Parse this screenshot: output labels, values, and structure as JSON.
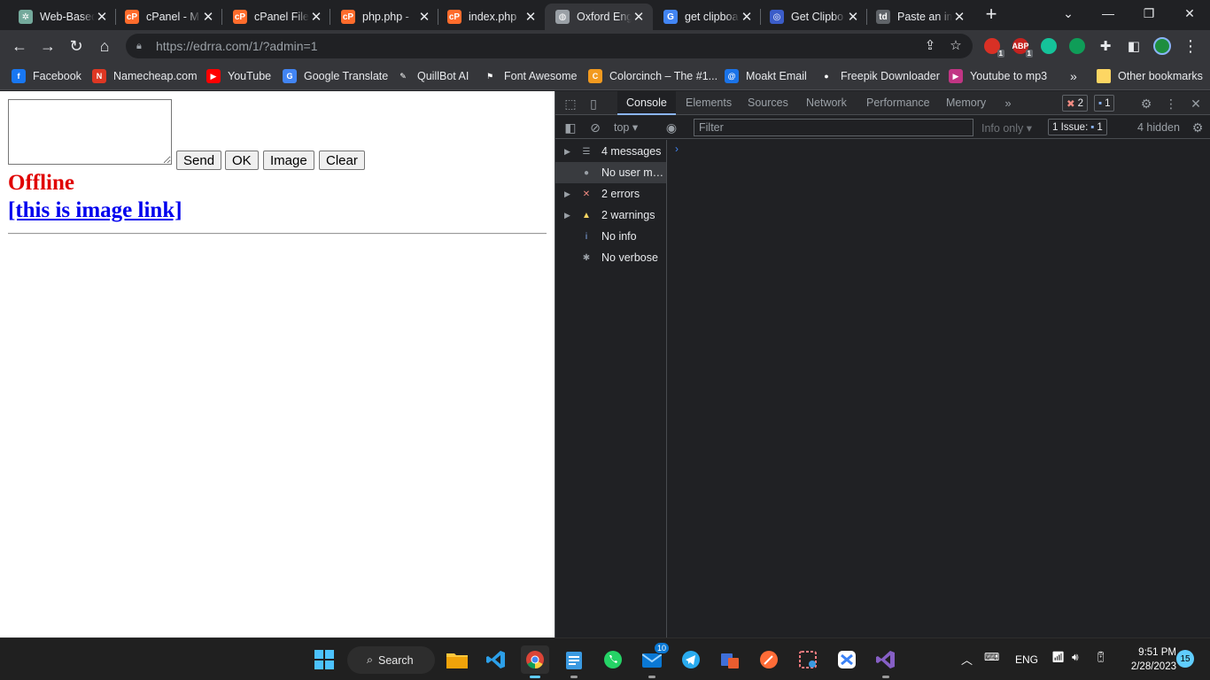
{
  "tabs": [
    {
      "label": "Web-Based",
      "icon": "chatgpt-icon",
      "color": "#74aa9c"
    },
    {
      "label": "cPanel - M",
      "icon": "cpanel-icon",
      "color": "#ff6c2c"
    },
    {
      "label": "cPanel File",
      "icon": "cpanel-icon",
      "color": "#ff6c2c"
    },
    {
      "label": "php.php -",
      "icon": "cpanel-icon",
      "color": "#ff6c2c"
    },
    {
      "label": "index.php",
      "icon": "cpanel-icon",
      "color": "#ff6c2c"
    },
    {
      "label": "Oxford Eng",
      "icon": "globe-icon",
      "color": "#9aa0a6",
      "active": true
    },
    {
      "label": "get clipboa",
      "icon": "google-icon",
      "color": "#4285f4"
    },
    {
      "label": "Get Clipbo",
      "icon": "codepen-icon",
      "color": "#3b5dc9"
    },
    {
      "label": "Paste an im",
      "icon": "td-icon",
      "color": "#5f6368"
    }
  ],
  "toolbar": {
    "url": "https://edrra.com/1/?admin=1"
  },
  "extensions": [
    {
      "name": "adblock-icon",
      "color": "#d93025",
      "text": "",
      "badge": "1"
    },
    {
      "name": "abp-icon",
      "color": "#c5221f",
      "text": "ABP",
      "badge": "1"
    },
    {
      "name": "grammarly-icon",
      "color": "#15c39a",
      "text": "",
      "badge": ""
    },
    {
      "name": "play-icon",
      "color": "#0f9d58",
      "text": "",
      "badge": ""
    }
  ],
  "bookmarks": [
    {
      "label": "Facebook",
      "icon": "facebook-icon",
      "color": "#1877f2",
      "glyph": "f"
    },
    {
      "label": "Namecheap.com",
      "icon": "namecheap-icon",
      "color": "#de3723",
      "glyph": "N"
    },
    {
      "label": "YouTube",
      "icon": "youtube-icon",
      "color": "#ff0000",
      "glyph": "▶"
    },
    {
      "label": "Google Translate",
      "icon": "translate-icon",
      "color": "#4285f4",
      "glyph": "G"
    },
    {
      "label": "QuillBot AI",
      "icon": "quillbot-icon",
      "color": "#35363a",
      "glyph": "✎"
    },
    {
      "label": "Font Awesome",
      "icon": "fontawesome-icon",
      "color": "#35363a",
      "glyph": "⚑"
    },
    {
      "label": "Colorcinch – The #1...",
      "icon": "colorcinch-icon",
      "color": "#f29a1f",
      "glyph": "C"
    },
    {
      "label": "Moakt Email",
      "icon": "moakt-icon",
      "color": "#1a73e8",
      "glyph": "@"
    },
    {
      "label": "Freepik Downloader",
      "icon": "freepik-icon",
      "color": "#35363a",
      "glyph": "●"
    },
    {
      "label": "Youtube to mp3",
      "icon": "ytmp3-icon",
      "color": "#c13584",
      "glyph": "▶"
    }
  ],
  "bookmarks_more": "»",
  "other_bookmarks": "Other bookmarks",
  "page": {
    "buttons": [
      "Send",
      "OK",
      "Image",
      "Clear"
    ],
    "status": "Offline",
    "link": "[this is image link]"
  },
  "devtools": {
    "tabs": [
      "Console",
      "Elements",
      "Sources",
      "Network",
      "Performance",
      "Memory"
    ],
    "active_tab": "Console",
    "more_tabs": "»",
    "error_count": "2",
    "issue_count": "1",
    "context": "top",
    "filter_placeholder": "Filter",
    "level": "Info only",
    "issues_label": "1 Issue:",
    "issues_count": "1",
    "hidden": "4 hidden",
    "sidebar": [
      {
        "label": "4 messages",
        "icon": "list-icon",
        "expandable": true,
        "color": "#9aa0a6",
        "glyph": "☰"
      },
      {
        "label": "No user me...",
        "icon": "user-icon",
        "expandable": false,
        "color": "#9aa0a6",
        "glyph": "●",
        "selected": true
      },
      {
        "label": "2 errors",
        "icon": "error-icon",
        "expandable": true,
        "color": "#f28b82",
        "glyph": "✕"
      },
      {
        "label": "2 warnings",
        "icon": "warning-icon",
        "expandable": true,
        "color": "#fdd663",
        "glyph": "▲"
      },
      {
        "label": "No info",
        "icon": "info-icon",
        "expandable": false,
        "color": "#8ab4f8",
        "glyph": "i"
      },
      {
        "label": "No verbose",
        "icon": "bug-icon",
        "expandable": false,
        "color": "#9aa0a6",
        "glyph": "✱"
      }
    ],
    "prompt": "›"
  },
  "taskbar": {
    "search_label": "Search",
    "notifications_badge": "10",
    "language": "ENG",
    "time": "9:51 PM",
    "date": "2/28/2023",
    "notification_count": "15"
  }
}
